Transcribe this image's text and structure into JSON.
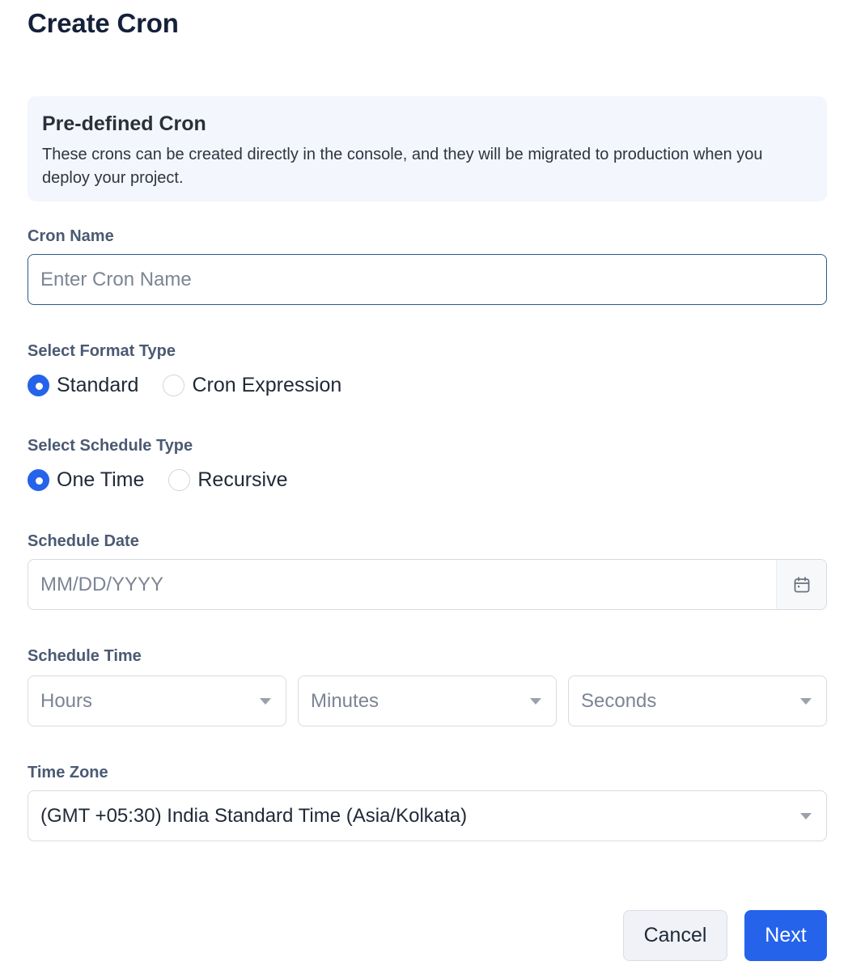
{
  "page": {
    "title": "Create Cron"
  },
  "info": {
    "title": "Pre-defined Cron",
    "description": "These crons can be created directly in the console, and they will be migrated to production when you deploy your project."
  },
  "cron_name": {
    "label": "Cron Name",
    "placeholder": "Enter Cron Name",
    "value": ""
  },
  "format_type": {
    "label": "Select Format Type",
    "options": [
      {
        "label": "Standard",
        "selected": true
      },
      {
        "label": "Cron Expression",
        "selected": false
      }
    ]
  },
  "schedule_type": {
    "label": "Select Schedule Type",
    "options": [
      {
        "label": "One Time",
        "selected": true
      },
      {
        "label": "Recursive",
        "selected": false
      }
    ]
  },
  "schedule_date": {
    "label": "Schedule Date",
    "placeholder": "MM/DD/YYYY",
    "icon": "calendar-icon"
  },
  "schedule_time": {
    "label": "Schedule Time",
    "hours_placeholder": "Hours",
    "minutes_placeholder": "Minutes",
    "seconds_placeholder": "Seconds"
  },
  "time_zone": {
    "label": "Time Zone",
    "value": "(GMT +05:30) India Standard Time (Asia/Kolkata)"
  },
  "actions": {
    "cancel_label": "Cancel",
    "next_label": "Next"
  },
  "colors": {
    "accent": "#2563eb",
    "info_bg": "#f3f6fd",
    "title": "#15213a",
    "label": "#4b5a73"
  }
}
